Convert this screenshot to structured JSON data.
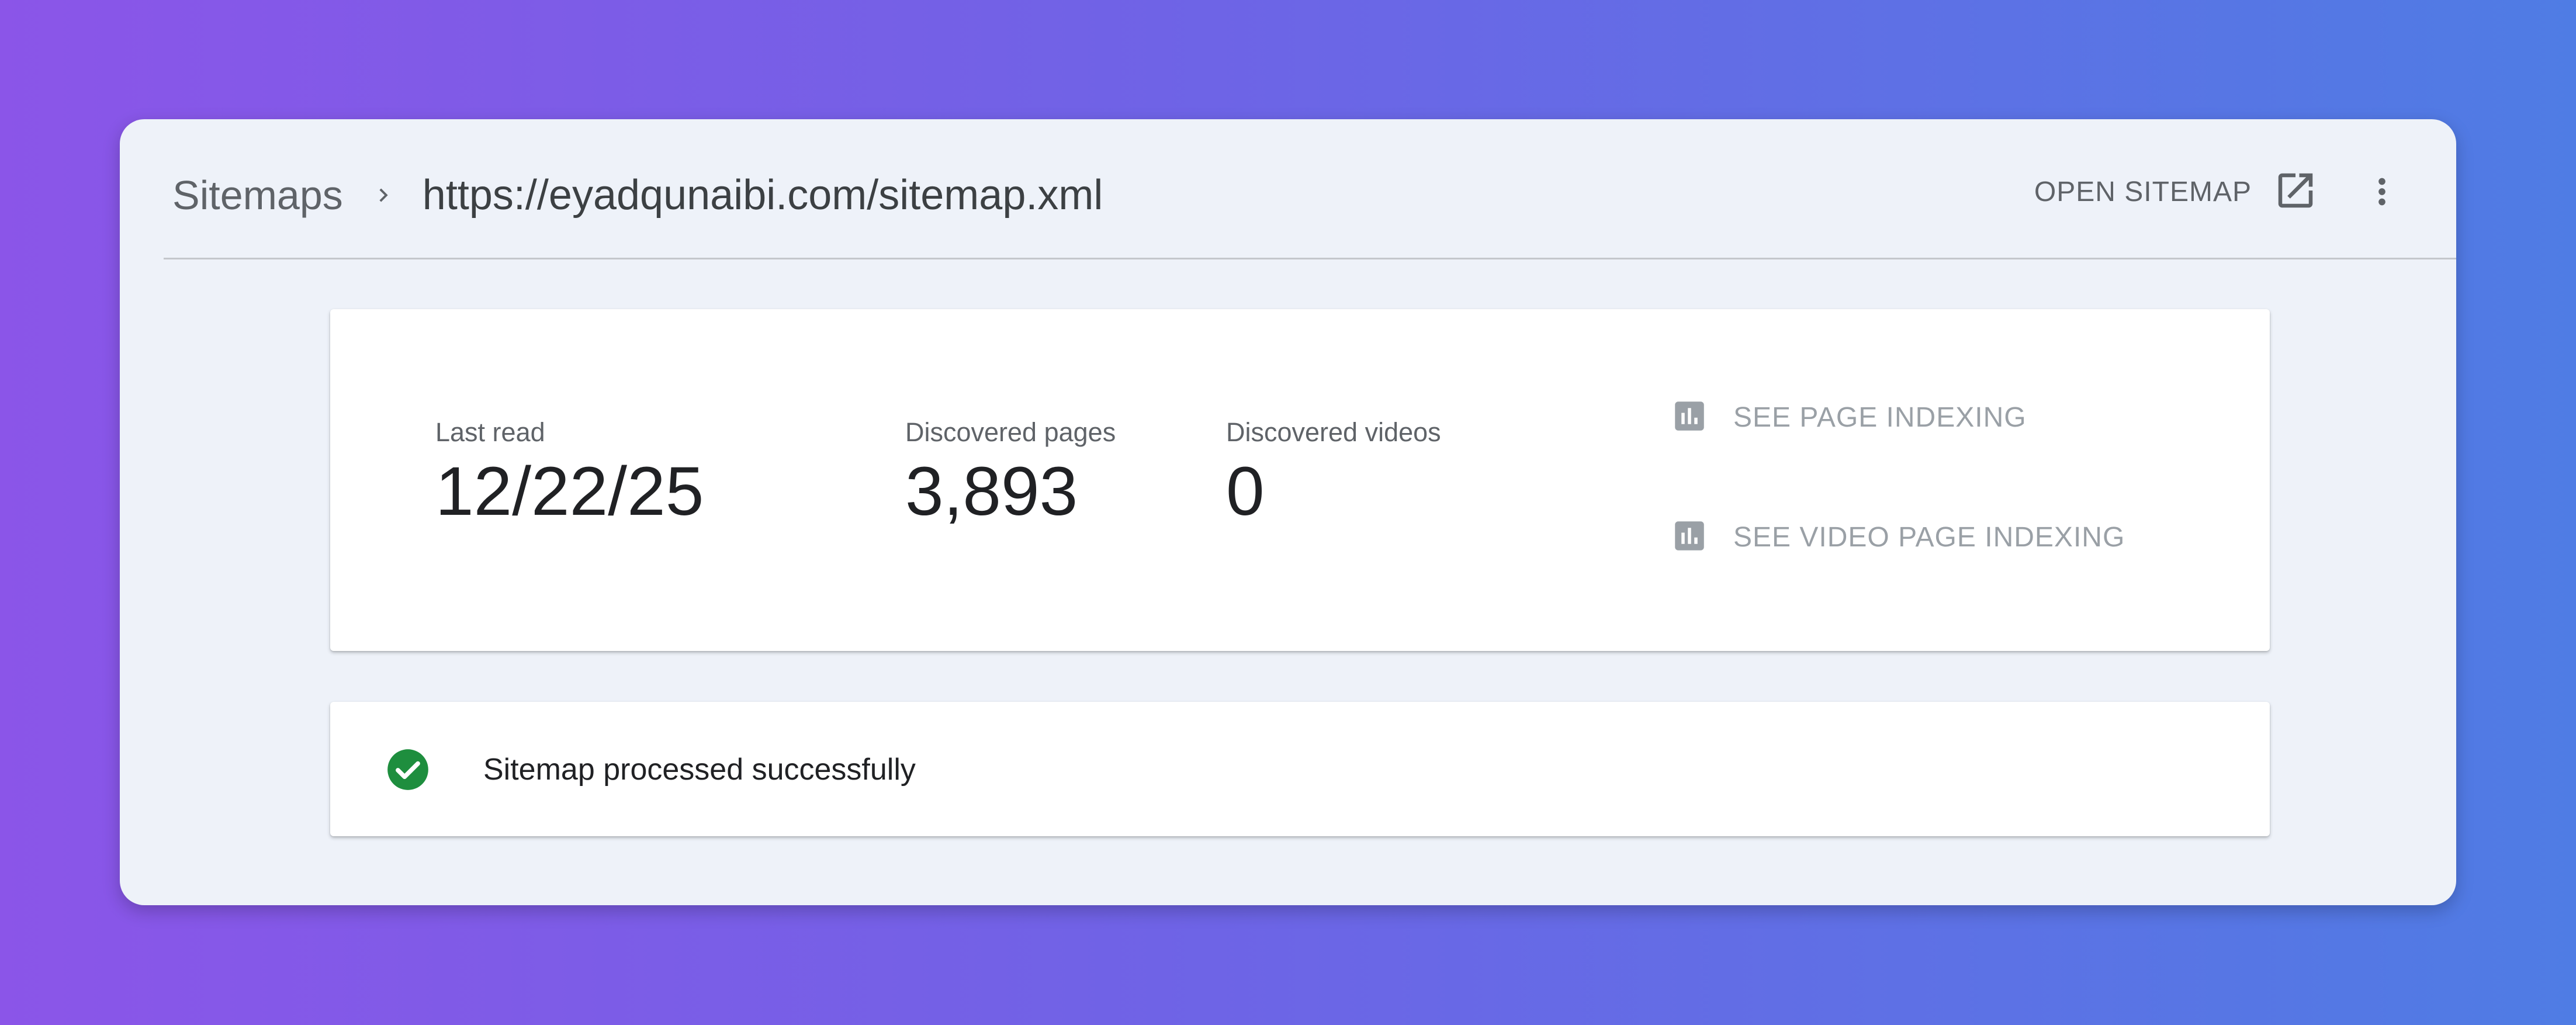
{
  "breadcrumb": {
    "root": "Sitemaps",
    "separator_icon": "chevron-right-icon",
    "current": "https://eyadqunaibi.com/sitemap.xml"
  },
  "header_actions": {
    "open_sitemap_label": "OPEN SITEMAP",
    "open_sitemap_icon": "open-in-new-icon",
    "more_icon": "more-vert-icon"
  },
  "stats": {
    "last_read": {
      "label": "Last read",
      "value": "12/22/25"
    },
    "discovered_pages": {
      "label": "Discovered pages",
      "value": "3,893"
    },
    "discovered_videos": {
      "label": "Discovered videos",
      "value": "0"
    }
  },
  "links": {
    "page_indexing": {
      "label": "SEE PAGE INDEXING",
      "icon": "bar-chart-icon"
    },
    "video_page_indexing": {
      "label": "SEE VIDEO PAGE INDEXING",
      "icon": "bar-chart-icon"
    }
  },
  "status": {
    "icon": "check-circle-icon",
    "text": "Sitemap processed successfully"
  },
  "colors": {
    "background_gradient_start": "#8b55e8",
    "background_gradient_end": "#4f7ce4",
    "panel_background": "#eef2f9",
    "success_green": "#1e8e3e",
    "link_gray": "#9aa0a6"
  }
}
